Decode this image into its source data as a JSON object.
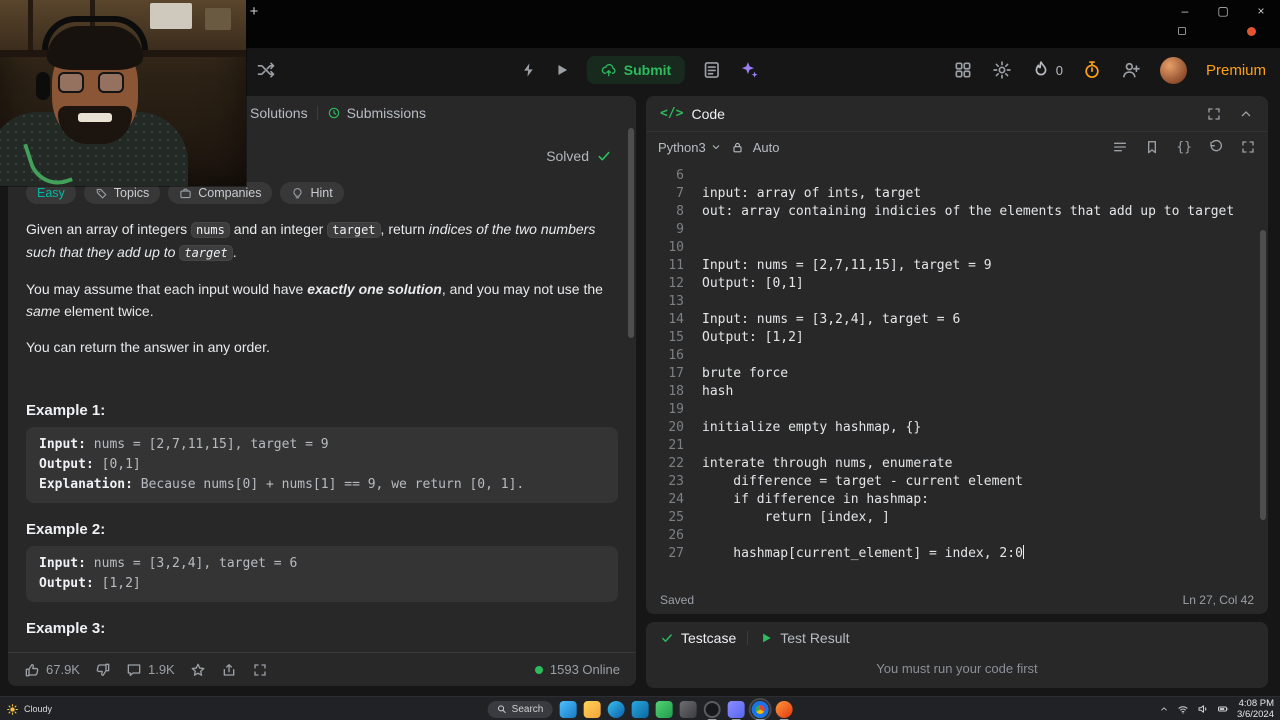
{
  "colors": {
    "green": "#2cbb5d",
    "easy": "#00b8a3",
    "premium": "#ffa116",
    "timer": "#ffa116",
    "sparkle": "#9a7ef5"
  },
  "chrome": {
    "new_tab": "+",
    "minimize": "–",
    "maximize": "▢",
    "close": "×"
  },
  "navbar": {
    "submit": "Submit",
    "streak": "0",
    "premium": "Premium"
  },
  "problem": {
    "tab_solutions": "Solutions",
    "tab_submissions": "Submissions",
    "solved": "Solved",
    "tag_easy": "Easy",
    "tag_topics": "Topics",
    "tag_companies": "Companies",
    "tag_hint": "Hint",
    "p1_t1": "Given an array of integers ",
    "p1_c1": "nums",
    "p1_t2": " and an integer ",
    "p1_c2": "target",
    "p1_t3": ", return ",
    "p1_i": "indices of the two numbers such that they add up to ",
    "p1_c3": "target",
    "p1_t4": ".",
    "p2_t1": "You may assume that each input would have ",
    "p2_b": "exactly one solution",
    "p2_t2": ", and you may not use the ",
    "p2_i": "same",
    "p2_t3": " element twice.",
    "p3": "You can return the answer in any order.",
    "examples": [
      {
        "title": "Example 1:",
        "input_label": "Input:",
        "input_value": " nums = [2,7,11,15], target = 9",
        "output_label": "Output:",
        "output_value": " [0,1]",
        "explanation_label": "Explanation:",
        "explanation_value": " Because nums[0] + nums[1] == 9, we return [0, 1]."
      },
      {
        "title": "Example 2:",
        "input_label": "Input:",
        "input_value": " nums = [3,2,4], target = 6",
        "output_label": "Output:",
        "output_value": " [1,2]"
      },
      {
        "title": "Example 3:"
      }
    ],
    "footer": {
      "likes": "67.9K",
      "comments": "1.9K",
      "online": "1593 Online"
    }
  },
  "editor": {
    "code_glyph": "</>",
    "title": "Code",
    "language": "Python3",
    "auto": "Auto",
    "braces": "{}",
    "saved": "Saved",
    "cursor": "Ln 27, Col 42",
    "lines": [
      {
        "n": "6",
        "t": ""
      },
      {
        "n": "7",
        "t": "input: array of ints, target"
      },
      {
        "n": "8",
        "t": "out: array containing indicies of the elements that add up to target"
      },
      {
        "n": "9",
        "t": ""
      },
      {
        "n": "10",
        "t": ""
      },
      {
        "n": "11",
        "t": "Input: nums = [2,7,11,15], target = 9"
      },
      {
        "n": "12",
        "t": "Output: [0,1]"
      },
      {
        "n": "13",
        "t": ""
      },
      {
        "n": "14",
        "t": "Input: nums = [3,2,4], target = 6"
      },
      {
        "n": "15",
        "t": "Output: [1,2]"
      },
      {
        "n": "16",
        "t": ""
      },
      {
        "n": "17",
        "t": "brute force"
      },
      {
        "n": "18",
        "t": "hash"
      },
      {
        "n": "19",
        "t": ""
      },
      {
        "n": "20",
        "t": "initialize empty hashmap, {}"
      },
      {
        "n": "21",
        "t": ""
      },
      {
        "n": "22",
        "t": "interate through nums, enumerate"
      },
      {
        "n": "23",
        "t": "    difference = target - current element"
      },
      {
        "n": "24",
        "t": "    if difference in hashmap:"
      },
      {
        "n": "25",
        "t": "        return [index, ]"
      },
      {
        "n": "26",
        "t": ""
      },
      {
        "n": "27",
        "t": "    hashmap[current_element] = index, 2:0"
      }
    ]
  },
  "console": {
    "testcase": "Testcase",
    "test_result": "Test Result",
    "message": "You must run your code first"
  },
  "taskbar": {
    "weather": "Cloudy",
    "search": "Search",
    "time": "4:08 PM",
    "date": "3/6/2024"
  }
}
